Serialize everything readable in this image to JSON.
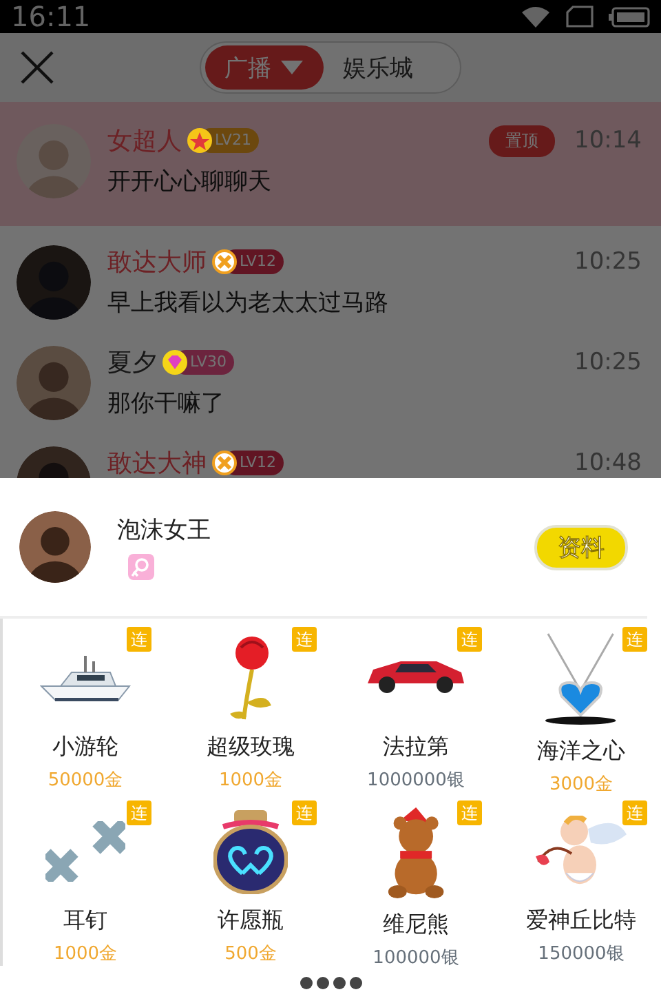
{
  "status_bar": {
    "time": "16:11"
  },
  "header": {
    "tabs": [
      {
        "label": "广播",
        "selected": true,
        "dropdown": true
      },
      {
        "label": "娱乐城",
        "selected": false,
        "dropdown": false
      }
    ]
  },
  "messages": [
    {
      "name": "女超人",
      "vip": true,
      "badge": {
        "kind": "star",
        "label": "LV21"
      },
      "text": "开开心心聊聊天",
      "time": "10:14",
      "pinned": true,
      "pin_label": "置顶"
    },
    {
      "name": "敢达大师",
      "vip": true,
      "badge": {
        "kind": "cross",
        "label": "LV12"
      },
      "text": "早上我看以为老太太过马路",
      "time": "10:25",
      "pinned": false
    },
    {
      "name": "夏夕",
      "vip": false,
      "badge": {
        "kind": "gem",
        "label": "LV30"
      },
      "text": "那你干嘛了",
      "time": "10:25",
      "pinned": false
    },
    {
      "name": "敢达大神",
      "vip": true,
      "badge": {
        "kind": "cross",
        "label": "LV12"
      },
      "time": "10:48",
      "pinned": false
    }
  ],
  "profile": {
    "name": "泡沫女王",
    "button": "资料"
  },
  "gifts": [
    {
      "name": "小游轮",
      "price": "50000金",
      "color": "#f0a830",
      "combo": "连"
    },
    {
      "name": "超级玫瑰",
      "price": "1000金",
      "color": "#f0a830",
      "combo": "连"
    },
    {
      "name": "法拉第",
      "price": "1000000银",
      "color": "#66707a",
      "combo": "连"
    },
    {
      "name": "海洋之心",
      "price": "3000金",
      "color": "#f0a830",
      "combo": "连"
    },
    {
      "name": "耳钉",
      "price": "1000金",
      "color": "#f0a830",
      "combo": "连"
    },
    {
      "name": "许愿瓶",
      "price": "500金",
      "color": "#f0a830",
      "combo": "连"
    },
    {
      "name": "维尼熊",
      "price": "100000银",
      "color": "#66707a",
      "combo": "连"
    },
    {
      "name": "爱神丘比特",
      "price": "150000银",
      "color": "#66707a",
      "combo": "连"
    }
  ]
}
